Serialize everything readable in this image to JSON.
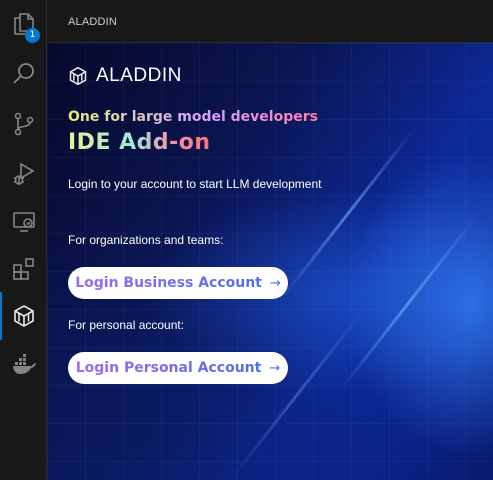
{
  "activity_bar": {
    "explorer_badge": "1",
    "items": [
      {
        "name": "explorer-icon"
      },
      {
        "name": "search-icon"
      },
      {
        "name": "source-control-icon"
      },
      {
        "name": "run-debug-icon"
      },
      {
        "name": "remote-explorer-icon"
      },
      {
        "name": "extensions-icon"
      },
      {
        "name": "aladdin-icon",
        "active": true
      },
      {
        "name": "docker-icon"
      }
    ]
  },
  "sidebar": {
    "title": "ALADDIN"
  },
  "panel": {
    "brand_name": "ALADDIN",
    "tagline": "One for large model developers",
    "headline": "IDE Add-on",
    "intro": "Login to your account to start LLM development",
    "org_label": "For organizations and teams:",
    "business_button": "Login Business Account",
    "personal_label": "For personal account:",
    "personal_button": "Login Personal Account",
    "arrow": "→"
  },
  "colors": {
    "accent": "#0078d4",
    "panel_background": "#0a2386",
    "button_text": "#4f6fe8"
  }
}
